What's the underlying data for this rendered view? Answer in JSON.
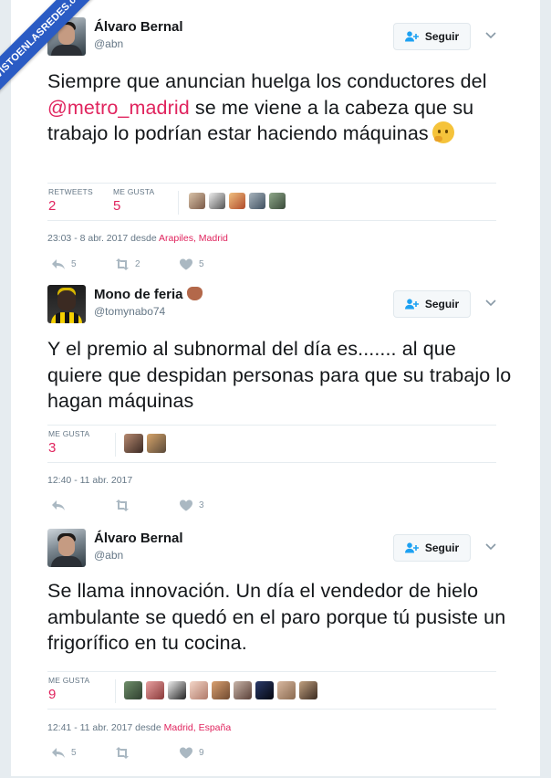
{
  "watermark": "VISTOENLASREDES.com",
  "follow_label": "Seguir",
  "tweets": [
    {
      "name": "Álvaro Bernal",
      "handle": "@abn",
      "text_before": "Siempre que anuncian huelga los conductores del ",
      "mention": "@metro_madrid",
      "text_after": " se me viene a la cabeza que su trabajo lo podrían estar haciendo máquinas",
      "emoji": "thinking-face",
      "stats": [
        {
          "label": "RETWEETS",
          "value": "2"
        },
        {
          "label": "ME GUSTA",
          "value": "5"
        }
      ],
      "liker_count": 5,
      "time": "23:03 - 8 abr. 2017 desde ",
      "place": "Arapiles, Madrid",
      "replies": "5",
      "retweets": "2",
      "likes": "5"
    },
    {
      "name": "Mono de feria",
      "handle": "@tomynabo74",
      "text": "Y el premio al subnormal del día es....... al que quiere que despidan personas para que su trabajo lo hagan máquinas",
      "emoji": "monkey-face",
      "stats": [
        {
          "label": "ME GUSTA",
          "value": "3"
        }
      ],
      "liker_count": 2,
      "time": "12:40 - 11 abr. 2017",
      "replies": "",
      "retweets": "",
      "likes": "3"
    },
    {
      "name": "Álvaro Bernal",
      "handle": "@abn",
      "text": "Se llama innovación. Un día el vendedor de hielo ambulante se quedó en el paro porque tú pusiste un frigorífico en tu cocina.",
      "stats": [
        {
          "label": "ME GUSTA",
          "value": "9"
        }
      ],
      "liker_count": 9,
      "time": "12:41 - 11 abr. 2017 desde ",
      "place": "Madrid, España",
      "replies": "5",
      "retweets": "",
      "likes": "9"
    }
  ],
  "colors": {
    "accent": "#e0245e",
    "muted": "#657786",
    "background": "#e6ecf0"
  }
}
